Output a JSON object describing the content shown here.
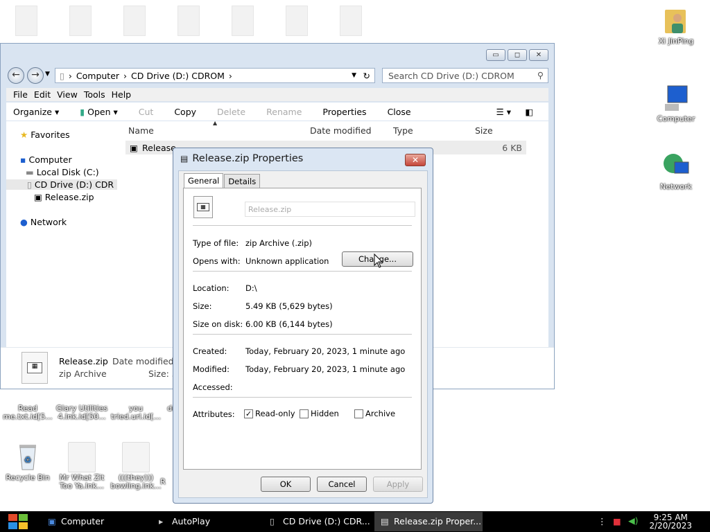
{
  "desktop": {
    "right_icons": [
      {
        "label": "Xi JinPing"
      },
      {
        "label": "Computer"
      },
      {
        "label": "Network"
      }
    ],
    "left_icons": [
      {
        "label": "Read me.txt.id[5..."
      },
      {
        "label": "Glary Utilities 4.lnk.id[50..."
      },
      {
        "label": "you tried.url.id[..."
      },
      {
        "label": "de"
      },
      {
        "label": "Recycle Bin"
      },
      {
        "label": "Mr What Zit Too Ya.lnk..."
      },
      {
        "label": "(((they))) bowling.lnk..."
      },
      {
        "label": "R"
      }
    ]
  },
  "explorer": {
    "address": [
      "Computer",
      "CD Drive (D:) CDROM"
    ],
    "search_placeholder": "Search CD Drive (D:) CDROM",
    "menu": [
      "File",
      "Edit",
      "View",
      "Tools",
      "Help"
    ],
    "toolbar": {
      "organize": "Organize",
      "open": "Open",
      "cut": "Cut",
      "copy": "Copy",
      "delete": "Delete",
      "rename": "Rename",
      "properties": "Properties",
      "close": "Close"
    },
    "nav": {
      "favorites": "Favorites",
      "computer": "Computer",
      "local_disk": "Local Disk (C:)",
      "cd_drive": "CD Drive (D:) CDR",
      "release": "Release.zip",
      "network": "Network"
    },
    "columns": {
      "name": "Name",
      "date": "Date modified",
      "type": "Type",
      "size": "Size"
    },
    "file_row": {
      "name": "Release",
      "size": "6 KB"
    },
    "details": {
      "name": "Release.zip",
      "type": "zip Archive",
      "date_label": "Date modified: 2",
      "size_label": "Size: 5"
    }
  },
  "dialog": {
    "title": "Release.zip Properties",
    "tabs": [
      "General",
      "Details"
    ],
    "filename": "Release.zip",
    "type_label": "Type of file:",
    "type_value": "zip Archive (.zip)",
    "opens_label": "Opens with:",
    "opens_value": "Unknown application",
    "change_button": "Change...",
    "location_label": "Location:",
    "location_value": "D:\\",
    "size_label": "Size:",
    "size_value": "5.49 KB (5,629 bytes)",
    "sizeondisk_label": "Size on disk:",
    "sizeondisk_value": "6.00 KB (6,144 bytes)",
    "created_label": "Created:",
    "created_value": "Today, February 20, 2023, 1 minute ago",
    "modified_label": "Modified:",
    "modified_value": "Today, February 20, 2023, 1 minute ago",
    "accessed_label": "Accessed:",
    "attributes_label": "Attributes:",
    "readonly": "Read-only",
    "hidden": "Hidden",
    "archive": "Archive",
    "ok": "OK",
    "cancel": "Cancel",
    "apply": "Apply"
  },
  "taskbar": {
    "tasks": [
      "Computer",
      "AutoPlay",
      "CD Drive (D:) CDR...",
      "Release.zip Proper..."
    ],
    "time": "9:25 AM",
    "date": "2/20/2023"
  }
}
